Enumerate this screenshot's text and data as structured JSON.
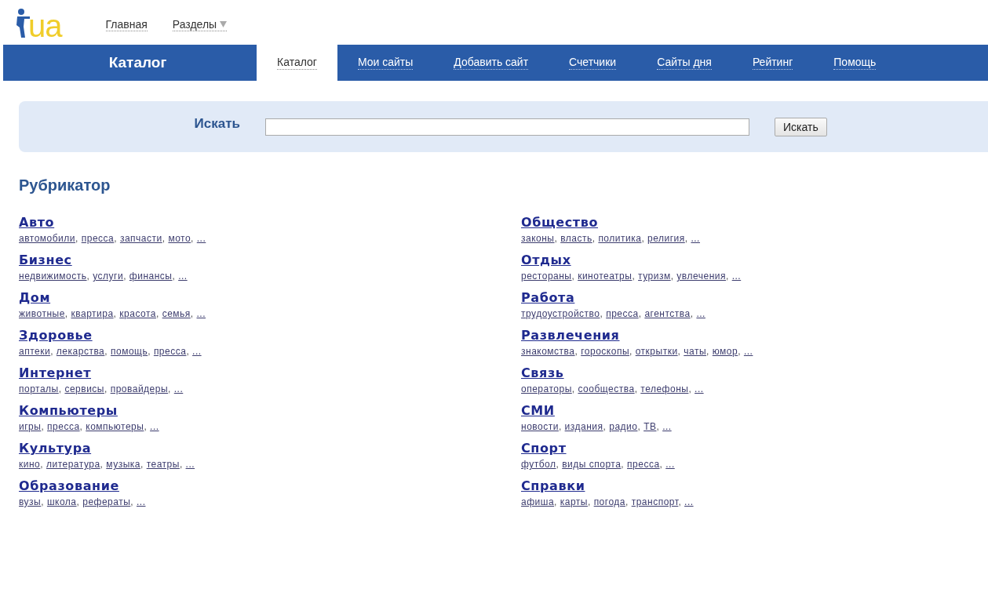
{
  "logo": {
    "text": "ua"
  },
  "top_links": [
    {
      "label": "Главная",
      "kind": "link"
    },
    {
      "label": "Разделы",
      "kind": "dropdown"
    }
  ],
  "navbar": {
    "title": "Каталог",
    "tabs": [
      {
        "label": "Каталог",
        "selected": true
      },
      {
        "label": "Мои сайты",
        "selected": false
      },
      {
        "label": "Добавить сайт",
        "selected": false
      },
      {
        "label": "Счетчики",
        "selected": false
      },
      {
        "label": "Сайты дня",
        "selected": false
      },
      {
        "label": "Рейтинг",
        "selected": false
      },
      {
        "label": "Помощь",
        "selected": false
      }
    ]
  },
  "search": {
    "label": "Искать",
    "button": "Искать"
  },
  "rubricator": {
    "title": "Рубрикатор",
    "separator": ",",
    "columns": [
      [
        {
          "name": "Авто",
          "links": [
            "автомобили",
            "пресса",
            "запчасти",
            "мото",
            "..."
          ]
        },
        {
          "name": "Бизнес",
          "links": [
            "недвижимость",
            "услуги",
            "финансы",
            "..."
          ]
        },
        {
          "name": "Дом",
          "links": [
            "животные",
            "квартира",
            "красота",
            "семья",
            "..."
          ]
        },
        {
          "name": "Здоровье",
          "links": [
            "аптеки",
            "лекарства",
            "помощь",
            "пресса",
            "..."
          ]
        },
        {
          "name": "Интернет",
          "links": [
            "порталы",
            "сервисы",
            "провайдеры",
            "..."
          ]
        },
        {
          "name": "Компьютеры",
          "links": [
            "игры",
            "пресса",
            "компьютеры",
            "..."
          ]
        },
        {
          "name": "Культура",
          "links": [
            "кино",
            "литература",
            "музыка",
            "театры",
            "..."
          ]
        },
        {
          "name": "Образование",
          "links": [
            "вузы",
            "школа",
            "рефераты",
            "..."
          ]
        }
      ],
      [
        {
          "name": "Общество",
          "links": [
            "законы",
            "власть",
            "политика",
            "религия",
            "..."
          ]
        },
        {
          "name": "Отдых",
          "links": [
            "рестораны",
            "кинотеатры",
            "туризм",
            "увлечения",
            "..."
          ]
        },
        {
          "name": "Работа",
          "links": [
            "трудоустройство",
            "пресса",
            "агентства",
            "..."
          ]
        },
        {
          "name": "Развлечения",
          "links": [
            "знакомства",
            "гороскопы",
            "открытки",
            "чаты",
            "юмор",
            "..."
          ]
        },
        {
          "name": "Связь",
          "links": [
            "операторы",
            "сообщества",
            "телефоны",
            "..."
          ]
        },
        {
          "name": "СМИ",
          "links": [
            "новости",
            "издания",
            "радио",
            "ТВ",
            "..."
          ]
        },
        {
          "name": "Спорт",
          "links": [
            "футбол",
            "виды спорта",
            "пресса",
            "..."
          ]
        },
        {
          "name": "Справки",
          "links": [
            "афиша",
            "карты",
            "погода",
            "транспорт",
            "..."
          ]
        }
      ]
    ]
  }
}
